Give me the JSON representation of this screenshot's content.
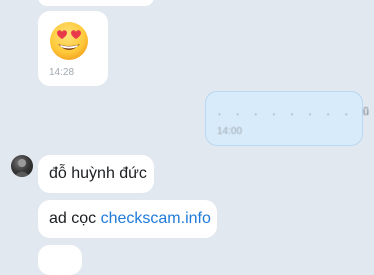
{
  "messages": [
    {
      "id": "msg-emoji",
      "type": "emoji",
      "emoji": "heart-eyes",
      "time": "14:28"
    },
    {
      "id": "msg-outgoing",
      "type": "text",
      "text": ". . . . . . . . ũi",
      "time": "14:00"
    },
    {
      "id": "msg-name",
      "type": "text",
      "text": "đỗ huỳnh đức"
    },
    {
      "id": "msg-link",
      "type": "text",
      "prefix": "ad cọc ",
      "link": "checkscam.info"
    }
  ],
  "colors": {
    "background": "#e2e8ef",
    "incoming_bubble": "#ffffff",
    "outgoing_bubble": "#d7ebfb",
    "link": "#1f7ad8"
  }
}
